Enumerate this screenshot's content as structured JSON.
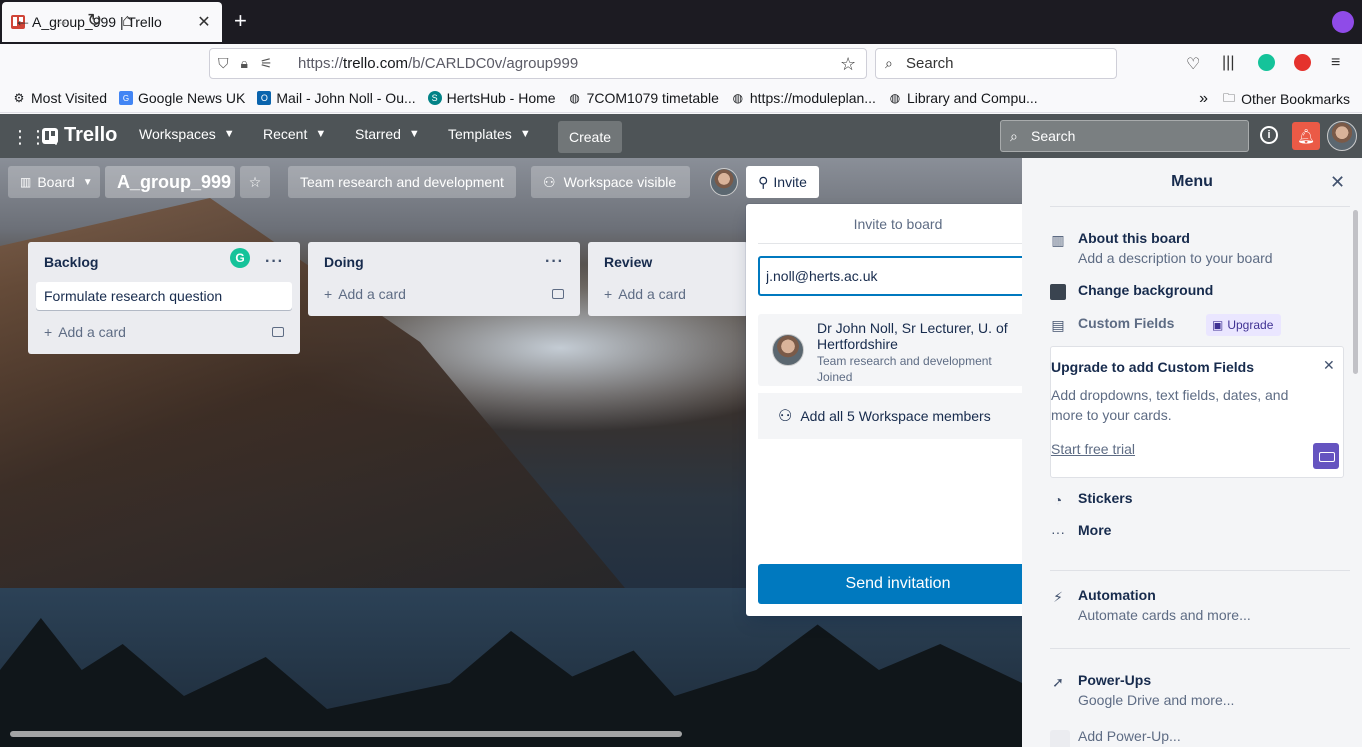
{
  "browser": {
    "tab_title": "A_group_999 | Trello",
    "url_prefix": "https://",
    "url_domain": "trello.com",
    "url_path": "/b/CARLDC0v/agroup999",
    "search_placeholder": "Search",
    "bookmarks": [
      {
        "label": "Most Visited",
        "icon": "gear-icon"
      },
      {
        "label": "Google News UK",
        "icon": "news-icon"
      },
      {
        "label": "Mail - John Noll - Ou...",
        "icon": "outlook-icon"
      },
      {
        "label": "HertsHub - Home",
        "icon": "sharepoint-icon"
      },
      {
        "label": "7COM1079 timetable",
        "icon": "globe-icon"
      },
      {
        "label": "https://moduleplan...",
        "icon": "globe-icon"
      },
      {
        "label": "Library and Compu...",
        "icon": "globe-icon"
      }
    ],
    "other_bookmarks": "Other Bookmarks"
  },
  "trello_header": {
    "logo": "Trello",
    "menus": [
      "Workspaces",
      "Recent",
      "Starred",
      "Templates"
    ],
    "create": "Create",
    "search_placeholder": "Search"
  },
  "board_bar": {
    "view": "Board",
    "title": "A_group_999",
    "workspace": "Team research and development",
    "visibility": "Workspace visible",
    "invite": "Invite"
  },
  "lists": [
    {
      "name": "Backlog",
      "cards": [
        "Formulate research question"
      ],
      "add": "Add a card"
    },
    {
      "name": "Doing",
      "cards": [],
      "add": "Add a card"
    },
    {
      "name": "Review",
      "cards": [],
      "add": "Add a card"
    }
  ],
  "invite_popover": {
    "title": "Invite to board",
    "email_value": "j.noll@herts.ac.uk",
    "suggestion_name": "Dr John Noll, Sr Lecturer, U. of Hertfordshire",
    "suggestion_team": "Team research and development",
    "suggestion_status": "Joined",
    "add_all": "Add all 5 Workspace members",
    "send": "Send invitation"
  },
  "menu": {
    "title": "Menu",
    "about_label": "About this board",
    "about_desc": "Add a description to your board",
    "change_bg": "Change background",
    "custom_fields": "Custom Fields",
    "upgrade_badge": "Upgrade",
    "upcard_title": "Upgrade to add Custom Fields",
    "upcard_desc": "Add dropdowns, text fields, dates, and more to your cards.",
    "upcard_link": "Start free trial",
    "stickers": "Stickers",
    "more": "More",
    "automation_label": "Automation",
    "automation_desc": "Automate cards and more...",
    "powerups_label": "Power-Ups",
    "powerups_desc": "Google Drive and more...",
    "add_powerup": "Add Power-Up..."
  },
  "colors": {
    "trello_blue": "#0079bf",
    "header_bg": "#4e5457",
    "notification_red": "#eb5a46",
    "upgrade_purple": "#6554c0"
  }
}
